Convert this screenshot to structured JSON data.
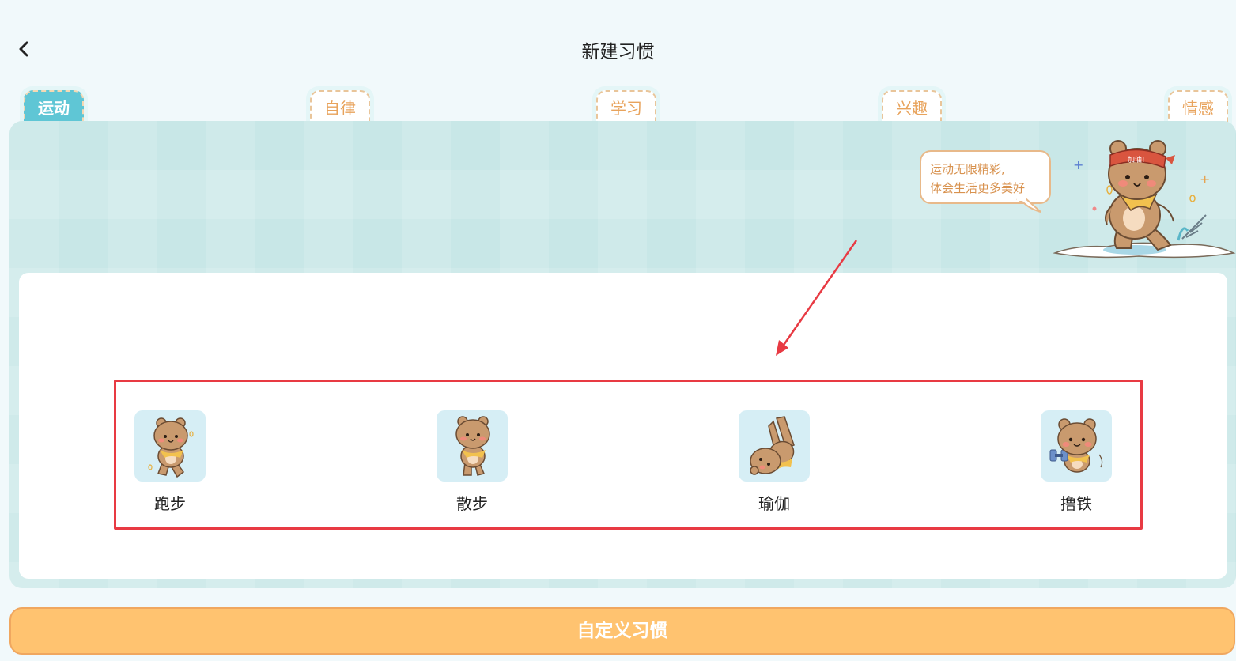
{
  "header": {
    "title": "新建习惯",
    "back_icon": "chevron-left-icon"
  },
  "tabs": [
    {
      "label": "运动",
      "active": true
    },
    {
      "label": "自律",
      "active": false
    },
    {
      "label": "学习",
      "active": false
    },
    {
      "label": "兴趣",
      "active": false
    },
    {
      "label": "情感",
      "active": false
    }
  ],
  "banner": {
    "bubble_line1": "运动无限精彩,",
    "bubble_line2": "体会生活更多美好",
    "headband_text": "加油!"
  },
  "habits": [
    {
      "label": "跑步",
      "icon": "bear-running-icon"
    },
    {
      "label": "散步",
      "icon": "bear-walking-icon"
    },
    {
      "label": "瑜伽",
      "icon": "bear-yoga-icon"
    },
    {
      "label": "撸铁",
      "icon": "bear-dumbbell-icon"
    }
  ],
  "footer": {
    "custom_button_label": "自定义习惯"
  },
  "colors": {
    "accent": "#5fc6d5",
    "tab_text": "#e8a35c",
    "button": "#ffc370",
    "highlight": "#e83a43"
  }
}
